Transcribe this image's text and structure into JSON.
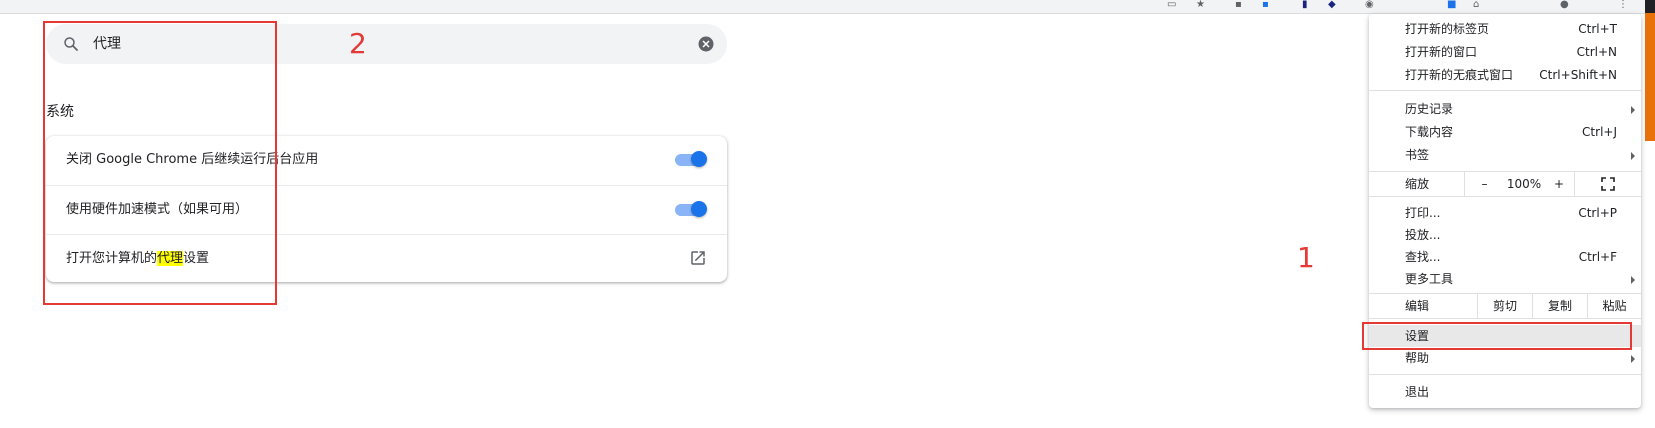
{
  "search": {
    "value": "代理"
  },
  "section": {
    "title": "系统"
  },
  "rows": [
    {
      "label": "关闭 Google Chrome 后继续运行后台应用",
      "enabled": true
    },
    {
      "label": "使用硬件加速模式（如果可用）",
      "enabled": true
    },
    {
      "label_prefix": "打开您计算机的",
      "label_highlight": "代理",
      "label_suffix": "设置"
    }
  ],
  "annotations": {
    "one": "1",
    "two": "2"
  },
  "menu": {
    "new_tab": {
      "label": "打开新的标签页",
      "shortcut": "Ctrl+T"
    },
    "new_window": {
      "label": "打开新的窗口",
      "shortcut": "Ctrl+N"
    },
    "incognito": {
      "label": "打开新的无痕式窗口",
      "shortcut": "Ctrl+Shift+N"
    },
    "history": {
      "label": "历史记录"
    },
    "downloads": {
      "label": "下载内容",
      "shortcut": "Ctrl+J"
    },
    "bookmarks": {
      "label": "书签"
    },
    "zoom": {
      "label": "缩放",
      "minus": "–",
      "value": "100%",
      "plus": "+"
    },
    "print": {
      "label": "打印...",
      "shortcut": "Ctrl+P"
    },
    "cast": {
      "label": "投放..."
    },
    "find": {
      "label": "查找...",
      "shortcut": "Ctrl+F"
    },
    "more_tools": {
      "label": "更多工具"
    },
    "edit": {
      "label": "编辑",
      "cut": "剪切",
      "copy": "复制",
      "paste": "粘贴"
    },
    "settings": {
      "label": "设置"
    },
    "help": {
      "label": "帮助"
    },
    "exit": {
      "label": "退出"
    }
  },
  "colors": {
    "accent": "#1a73e8",
    "annotation": "#e53935",
    "highlight": "#ffff00"
  }
}
